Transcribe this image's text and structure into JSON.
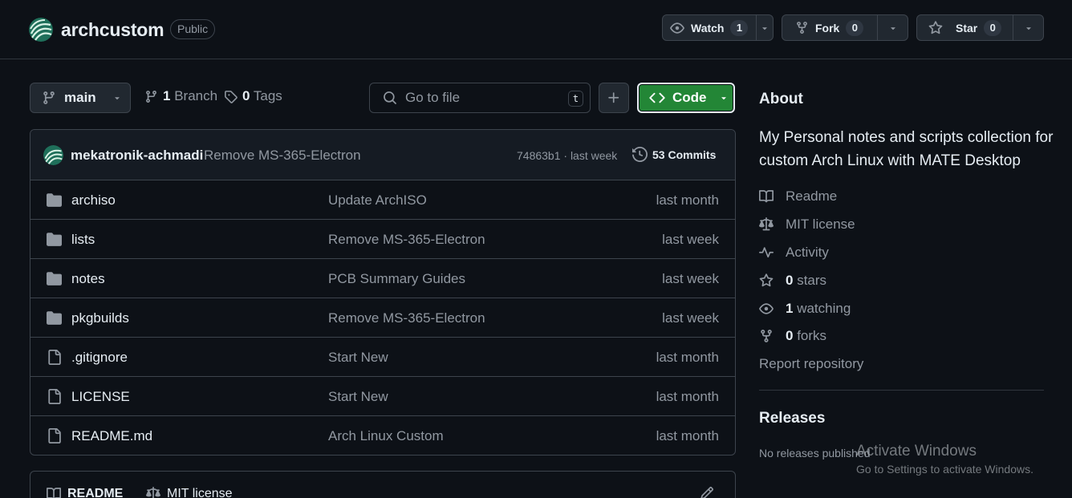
{
  "header": {
    "repo_name": "archcustom",
    "visibility": "Public",
    "watch": {
      "label": "Watch",
      "count": "1"
    },
    "fork": {
      "label": "Fork",
      "count": "0"
    },
    "star": {
      "label": "Star",
      "count": "0"
    }
  },
  "toolbar": {
    "branch": "main",
    "branches_count": "1",
    "branches_label": "Branch",
    "tags_count": "0",
    "tags_label": "Tags",
    "search_placeholder": "Go to file",
    "search_shortcut": "t",
    "code_label": "Code"
  },
  "latest_commit": {
    "author": "mekatronik-achmadi",
    "message": "Remove MS-365-Electron",
    "hash_time": "74863b1 · last week",
    "commits_label": "53 Commits"
  },
  "files": [
    {
      "type": "dir",
      "name": "archiso",
      "message": "Update ArchISO",
      "time": "last month"
    },
    {
      "type": "dir",
      "name": "lists",
      "message": "Remove MS-365-Electron",
      "time": "last week"
    },
    {
      "type": "dir",
      "name": "notes",
      "message": "PCB Summary Guides",
      "time": "last week"
    },
    {
      "type": "dir",
      "name": "pkgbuilds",
      "message": "Remove MS-365-Electron",
      "time": "last week"
    },
    {
      "type": "file",
      "name": ".gitignore",
      "message": "Start New",
      "time": "last month"
    },
    {
      "type": "file",
      "name": "LICENSE",
      "message": "Start New",
      "time": "last month"
    },
    {
      "type": "file",
      "name": "README.md",
      "message": "Arch Linux Custom",
      "time": "last month"
    }
  ],
  "readme_tabs": [
    "README",
    "MIT license"
  ],
  "sidebar": {
    "about_title": "About",
    "description": "My Personal notes and scripts collection for custom Arch Linux with MATE Desktop",
    "readme": "Readme",
    "license": "MIT license",
    "activity": "Activity",
    "stars_count": "0",
    "stars_label": "stars",
    "watching_count": "1",
    "watching_label": "watching",
    "forks_count": "0",
    "forks_label": "forks",
    "report": "Report repository",
    "releases_title": "Releases",
    "no_releases": "No releases published"
  },
  "watermark": {
    "title": "Activate Windows",
    "subtitle": "Go to Settings to activate Windows."
  },
  "colors": {
    "background": "#0d1117",
    "border": "#3d444d",
    "text": "#e6edf3",
    "muted": "#9198a1",
    "accent_green": "#238636",
    "folder_icon": "#9198a1"
  }
}
